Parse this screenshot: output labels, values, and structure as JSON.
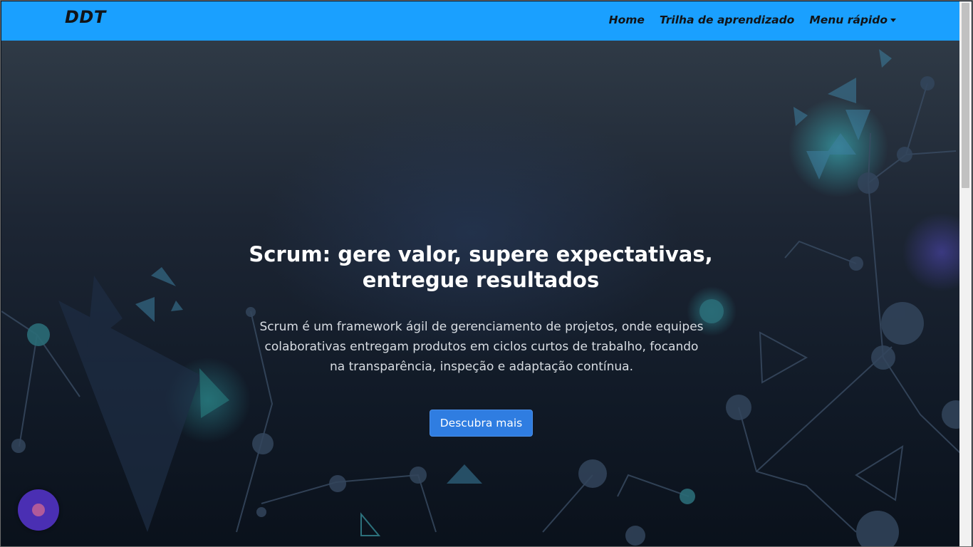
{
  "navbar": {
    "brand": "DDT",
    "links": [
      {
        "label": "Home"
      },
      {
        "label": "Trilha de aprendizado"
      },
      {
        "label": "Menu rápido",
        "has_dropdown": true
      }
    ],
    "background_color": "#1aa0ff"
  },
  "hero": {
    "title_line1": "Scrum: gere valor, supere expectativas,",
    "title_line2": "entregue resultados",
    "description_line1": "Scrum é um framework ágil de gerenciamento de projetos, onde equipes",
    "description_line2": "colaborativas entregam produtos em ciclos curtos de trabalho, focando",
    "description_line3": "na transparência, inspeção e adaptação contínua.",
    "cta_label": "Descubra mais",
    "cta_color": "#2f7de1"
  },
  "icons": {
    "dropdown": "caret-down-icon",
    "widget": "chat-widget-icon"
  }
}
